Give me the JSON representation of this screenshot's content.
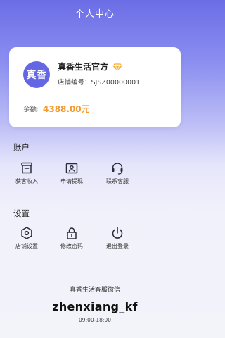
{
  "header": {
    "title": "个人中心"
  },
  "profile": {
    "avatar_text": "真香",
    "shop_name": "真香生活官方",
    "shop_id_label": "店铺编号：",
    "shop_id": "SJSZ00000001",
    "shop_id_text": "店铺编号：SJSZ00000001",
    "badge_icon": "diamond-icon",
    "balance_label": "余额:",
    "balance_value": "4388.00元"
  },
  "account": {
    "title": "账户",
    "items": [
      {
        "label": "获客收入",
        "icon": "wallet-icon"
      },
      {
        "label": "申请提现",
        "icon": "id-card-icon"
      },
      {
        "label": "联系客服",
        "icon": "headset-icon"
      }
    ]
  },
  "settings": {
    "title": "设置",
    "items": [
      {
        "label": "店铺设置",
        "icon": "gear-icon"
      },
      {
        "label": "修改密码",
        "icon": "lock-icon"
      },
      {
        "label": "退出登录",
        "icon": "power-icon"
      }
    ]
  },
  "customer_service": {
    "title": "真香生活客服微信",
    "wechat_id": "zhenxiang_kf",
    "hours": "09:00-18:00"
  },
  "colors": {
    "accent": "#6466e3",
    "balance": "#f39a2f",
    "badge": "#f5b13a",
    "icon": "#2b2b3a"
  }
}
